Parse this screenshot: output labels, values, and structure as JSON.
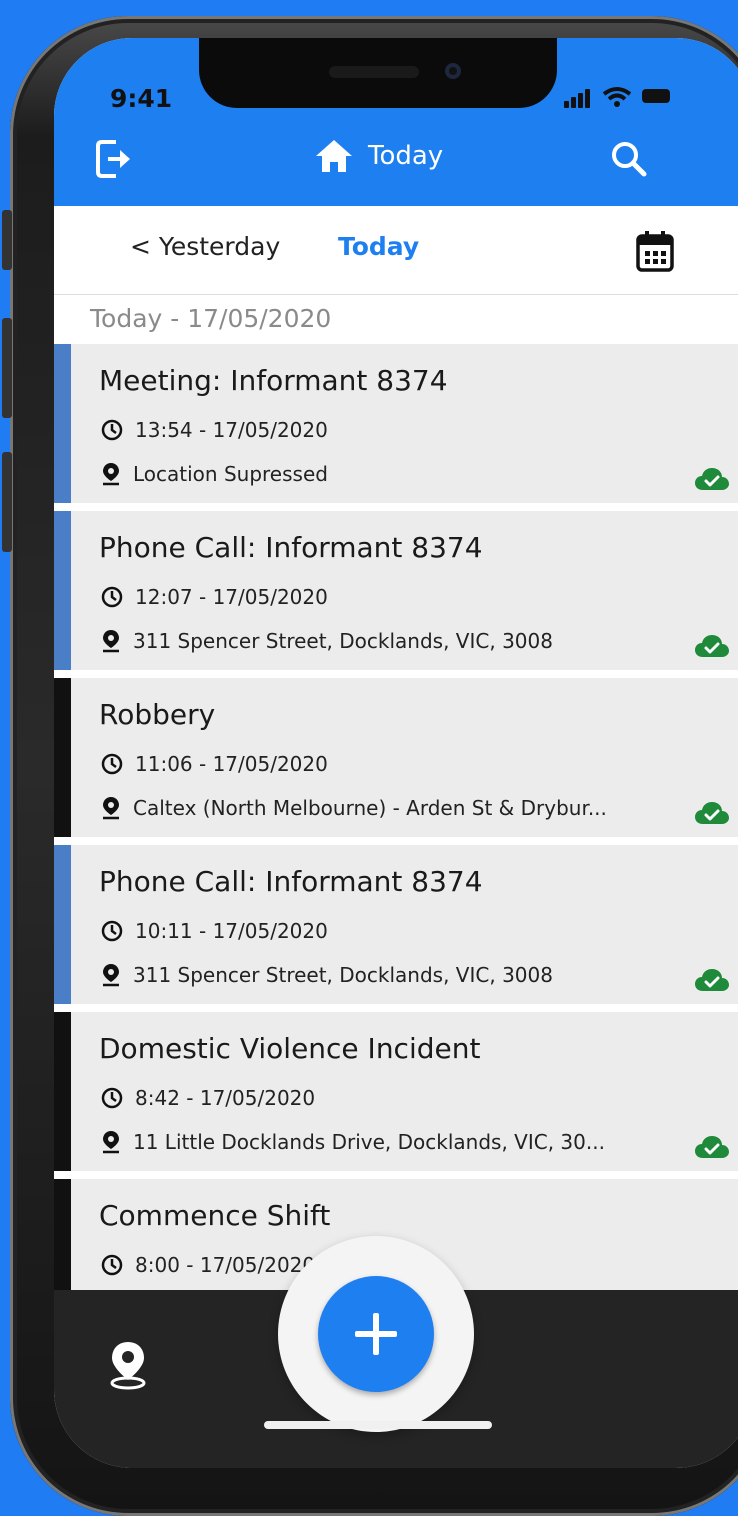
{
  "status_bar": {
    "time": "9:41"
  },
  "header": {
    "title": "Today"
  },
  "day_nav": {
    "prev_label": "< Yesterday",
    "current_label": "Today"
  },
  "list_heading": "Today - 17/05/2020",
  "entries": [
    {
      "title": "Meeting: Informant 8374",
      "time": "13:54 - 17/05/2020",
      "location": "Location Supressed",
      "accent": "#4a7fc8"
    },
    {
      "title": "Phone Call: Informant 8374",
      "time": "12:07 - 17/05/2020",
      "location": "311 Spencer Street, Docklands, VIC, 3008",
      "accent": "#4a7fc8"
    },
    {
      "title": "Robbery",
      "time": "11:06 - 17/05/2020",
      "location": "Caltex (North Melbourne) - Arden St & Drybur...",
      "accent": "#111111"
    },
    {
      "title": "Phone Call: Informant 8374",
      "time": "10:11 - 17/05/2020",
      "location": "311 Spencer Street, Docklands, VIC, 3008",
      "accent": "#4a7fc8"
    },
    {
      "title": "Domestic Violence Incident",
      "time": "8:42 - 17/05/2020",
      "location": "11 Little Docklands Drive, Docklands, VIC, 30...",
      "accent": "#111111"
    },
    {
      "title": "Commence Shift",
      "time": "8:00 - 17/05/2020",
      "location": "",
      "accent": "#111111"
    }
  ],
  "icons": {
    "logout": "exit-icon",
    "home": "home-icon",
    "search": "search-icon",
    "calendar": "calendar-icon",
    "clock": "clock-icon",
    "pin": "map-pin-icon",
    "synced": "cloud-check-icon",
    "add": "plus-icon"
  },
  "colors": {
    "brand_blue": "#1e7ff0",
    "accent_blue": "#4a7fc8",
    "synced_green": "#1e8a3a",
    "tab_bar": "#242424"
  }
}
